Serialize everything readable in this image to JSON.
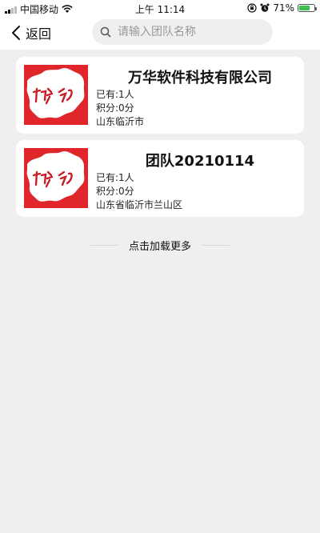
{
  "status_bar": {
    "carrier": "中国移动",
    "time": "上午 11:14",
    "battery": "71%",
    "battery_level": 0.71
  },
  "nav": {
    "back_label": "返回",
    "search_placeholder": "请输入团队名称",
    "search_value": ""
  },
  "teams": [
    {
      "name": "万华软件科技有限公司",
      "members": "已有:1人",
      "points": "积分:0分",
      "location": "山东临沂市"
    },
    {
      "name": "团队20210114",
      "members": "已有:1人",
      "points": "积分:0分",
      "location": "山东省临沂市兰山区"
    }
  ],
  "load_more": "点击加载更多",
  "colors": {
    "logo_red": "#e0262b",
    "background": "#efefef",
    "card": "#ffffff"
  }
}
